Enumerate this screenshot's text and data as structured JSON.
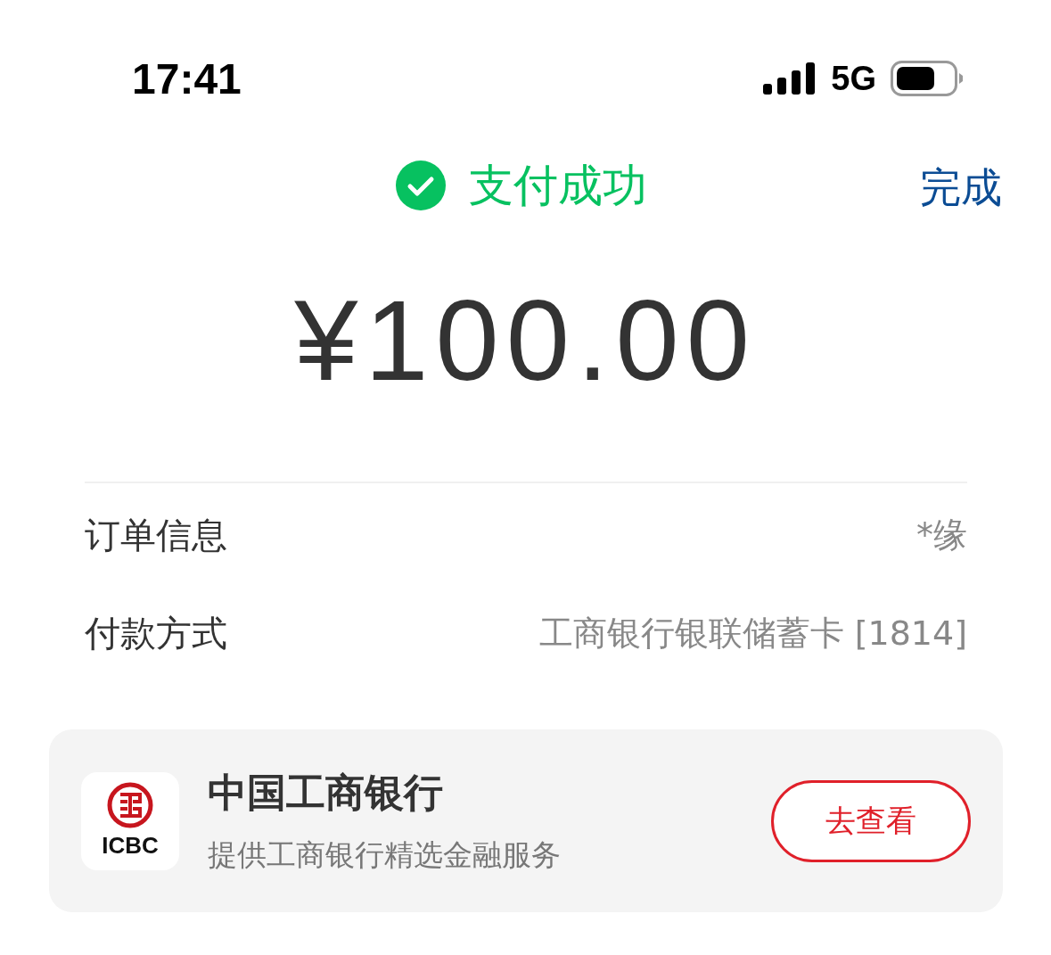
{
  "status_bar": {
    "time": "17:41",
    "network": "5G"
  },
  "header": {
    "title": "支付成功",
    "done": "完成"
  },
  "amount": "¥100.00",
  "details": [
    {
      "label": "订单信息",
      "value": "*缘"
    },
    {
      "label": "付款方式",
      "value": "工商银行银联储蓄卡 [1814]"
    }
  ],
  "promo": {
    "logo_text": "ICBC",
    "name": "中国工商银行",
    "subtitle": "提供工商银行精选金融服务",
    "button": "去查看"
  }
}
